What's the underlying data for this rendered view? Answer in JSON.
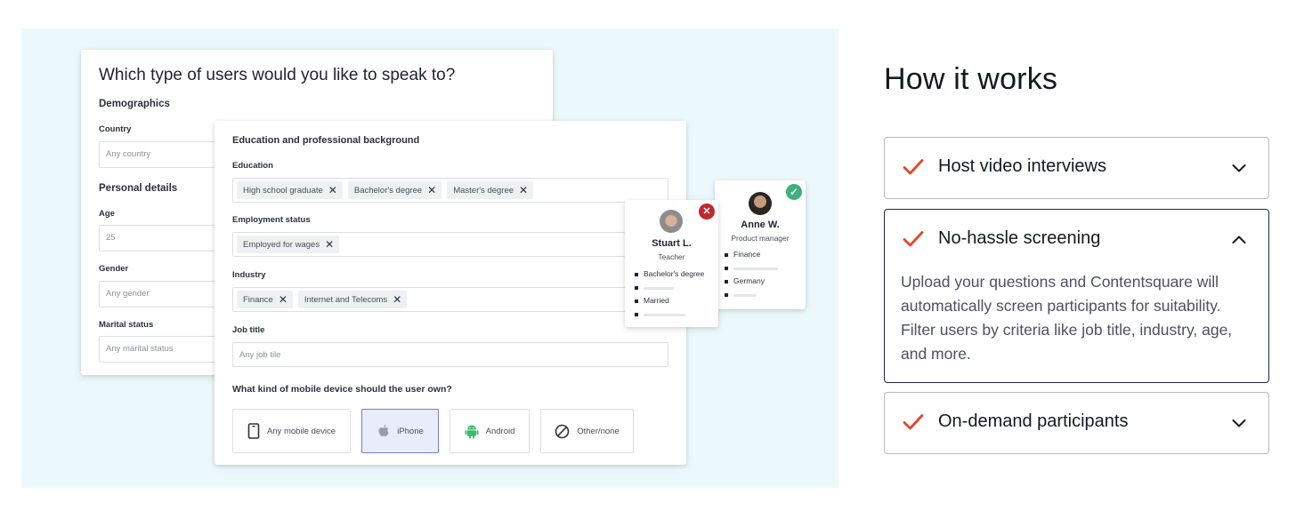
{
  "illustration": {
    "targeting_card": {
      "title": "Which type of users would you like to speak to?",
      "demographics_heading": "Demographics",
      "country": {
        "label": "Country",
        "placeholder": "Any country"
      },
      "personal_details_heading": "Personal details",
      "age": {
        "label": "Age",
        "value": "25"
      },
      "gender": {
        "label": "Gender",
        "placeholder": "Any gender"
      },
      "marital_status": {
        "label": "Marital status",
        "placeholder": "Any marital status"
      }
    },
    "background_card": {
      "heading": "Education and professional background",
      "education": {
        "label": "Education",
        "chips": [
          "High school graduate",
          "Bachelor's degree",
          "Master's degree"
        ]
      },
      "employment": {
        "label": "Employment status",
        "chips": [
          "Employed for wages"
        ]
      },
      "industry": {
        "label": "Industry",
        "chips": [
          "Finance",
          "Internet and Telecoms"
        ]
      },
      "job_title": {
        "label": "Job title",
        "placeholder": "Any job tile"
      },
      "device_question": "What kind of mobile device should the user own?",
      "devices": [
        {
          "label": "Any mobile device",
          "icon": "phone-outline-icon",
          "selected": false
        },
        {
          "label": "iPhone",
          "icon": "apple-icon",
          "selected": true
        },
        {
          "label": "Android",
          "icon": "android-icon",
          "selected": false
        },
        {
          "label": "Other/none",
          "icon": "prohibited-icon",
          "selected": false
        }
      ]
    },
    "participants": [
      {
        "name": "Stuart L.",
        "role": "Teacher",
        "status": "rejected",
        "status_color": "#c0282d",
        "items": [
          "Bachelor's degree",
          "",
          "Married",
          ""
        ]
      },
      {
        "name": "Anne W.",
        "role": "Product manager",
        "status": "accepted",
        "status_color": "#3cb179",
        "items": [
          "Finance",
          "",
          "Germany",
          ""
        ]
      }
    ]
  },
  "how_it_works": {
    "heading": "How it works",
    "accent_color": "#e8452c",
    "items": [
      {
        "title": "Host video interviews",
        "expanded": false
      },
      {
        "title": "No-hassle screening",
        "expanded": true,
        "body": "Upload your questions and Contentsquare will automatically screen participants for suitability. Filter users by criteria like job title, industry, age, and more."
      },
      {
        "title": "On-demand participants",
        "expanded": false
      }
    ]
  }
}
